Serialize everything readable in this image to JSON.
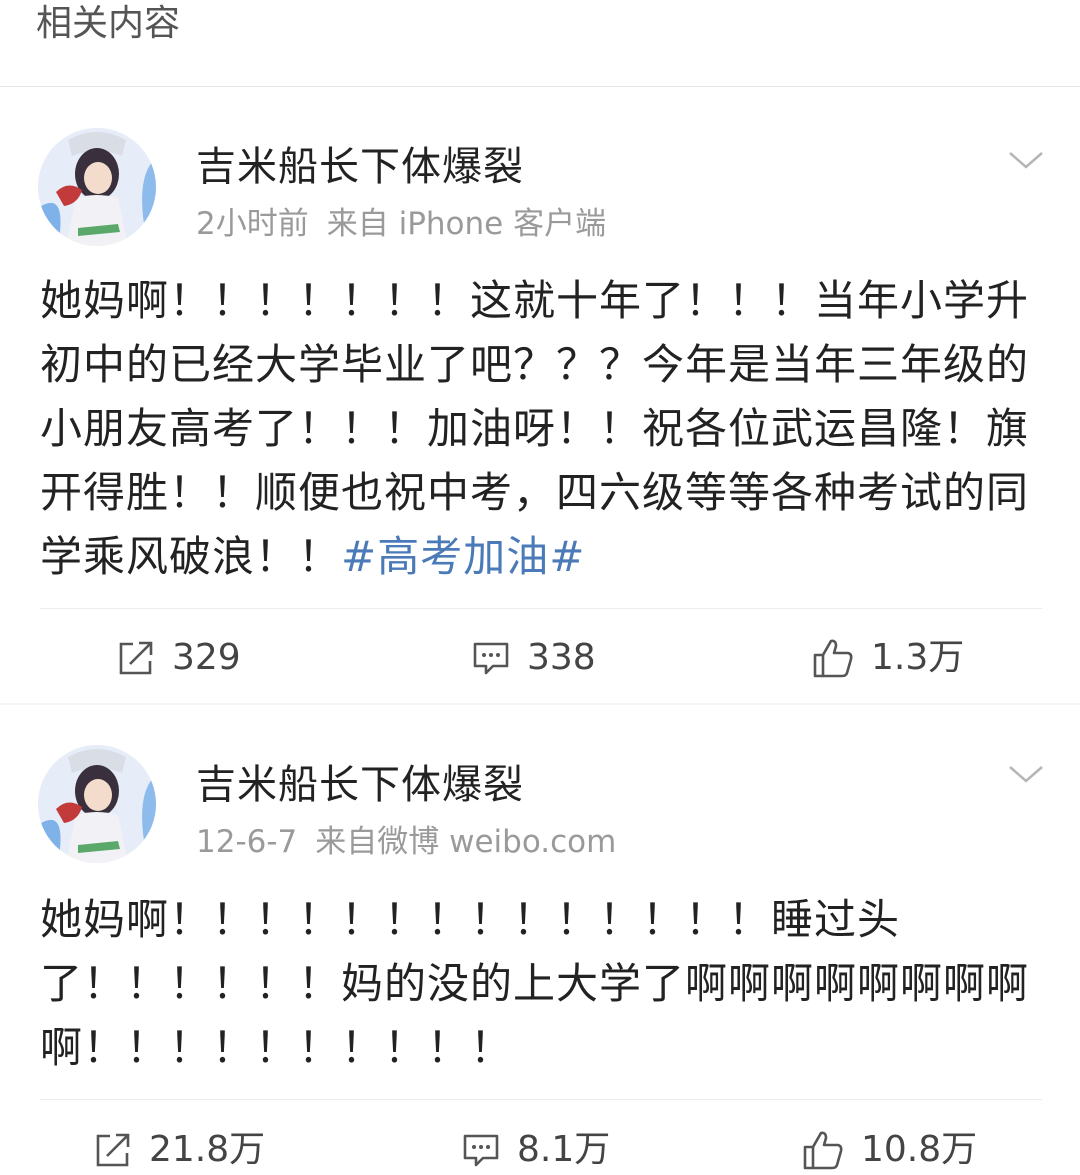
{
  "section": {
    "title": "相关内容"
  },
  "posts": [
    {
      "username": "吉米船长下体爆裂",
      "time": "2小时前",
      "source": "来自 iPhone 客户端",
      "text": "她妈啊！！！！！！！这就十年了！！！当年小学升初中的已经大学毕业了吧？？？今年是当年三年级的小朋友高考了！！！加油呀！！祝各位武运昌隆！旗开得胜！！顺便也祝中考，四六级等等各种考试的同学乘风破浪！！",
      "hashtag": "#高考加油#",
      "reposts": "329",
      "comments": "338",
      "likes": "1.3万"
    },
    {
      "username": "吉米船长下体爆裂",
      "time": "12-6-7",
      "source": "来自微博 weibo.com",
      "text": "她妈啊！！！！！！！！！！！！！！睡过头了！！！！！！妈的没的上大学了啊啊啊啊啊啊啊啊啊！！！！！！！！！！",
      "reposts": "21.8万",
      "comments": "8.1万",
      "likes": "10.8万"
    }
  ],
  "icons": {
    "repost": "repost-icon",
    "comment": "comment-icon",
    "like": "thumbs-up-icon",
    "menu": "chevron-down-icon"
  },
  "colors": {
    "hashtag": "#4b7ab8",
    "meta": "#9a9a9a",
    "text": "#222222",
    "background": "#ffffff",
    "separator": "#f5f5f5"
  }
}
